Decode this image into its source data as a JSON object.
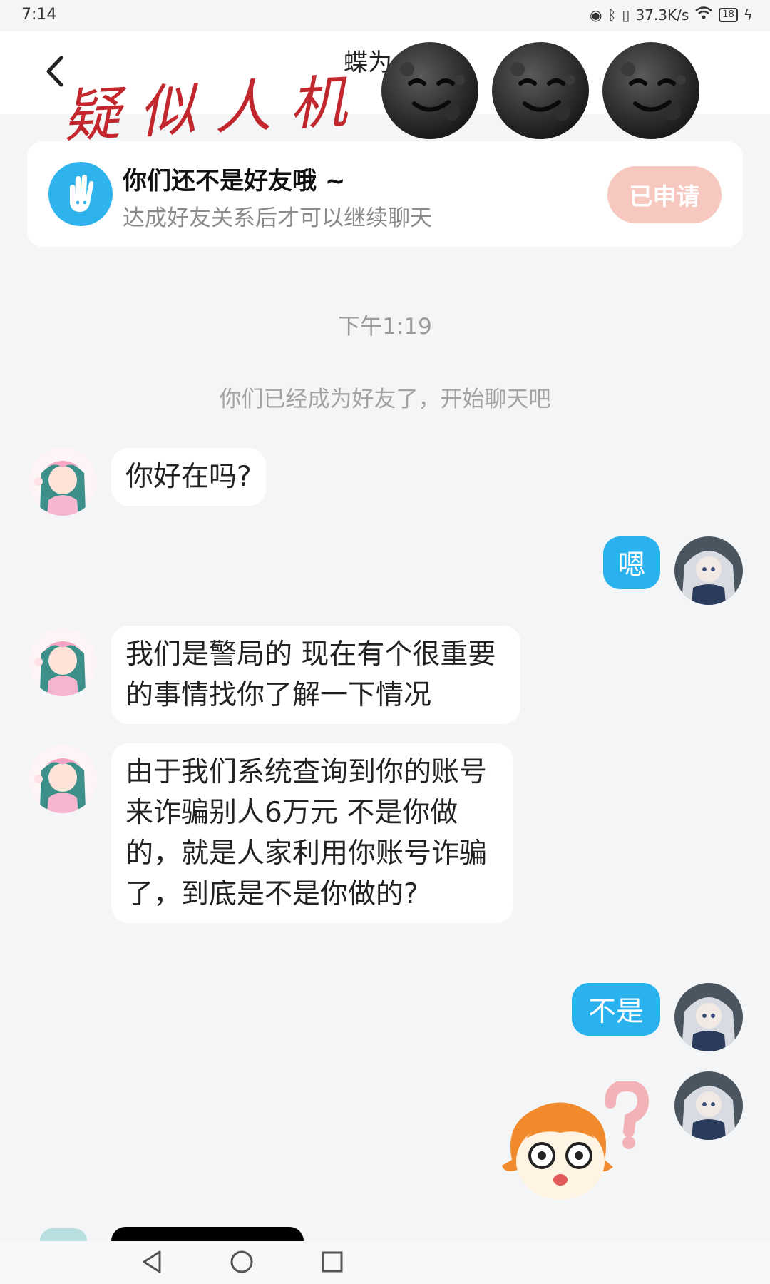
{
  "status_bar": {
    "time": "7:14",
    "net_speed": "37.3K/s",
    "battery": "18"
  },
  "header": {
    "title": "蝶为",
    "overlay_stamp": "疑似人机"
  },
  "notice": {
    "title": "你们还不是好友哦 ~",
    "subtitle": "达成好友关系后才可以继续聊天",
    "button_label": "已申请"
  },
  "chat": {
    "time_label": "下午1:19",
    "system_message": "你们已经成为好友了，开始聊天吧",
    "messages": [
      {
        "side": "in",
        "text": "你好在吗?"
      },
      {
        "side": "out",
        "text": "嗯"
      },
      {
        "side": "in",
        "text": "我们是警局的 现在有个很重要的事情找你了解一下情况"
      },
      {
        "side": "in",
        "text": "由于我们系统查询到你的账号来诈骗别人6万元 不是你做的，就是人家利用你账号诈骗了，到底是不是你做的?"
      },
      {
        "side": "out",
        "text": "不是"
      },
      {
        "side": "out",
        "sticker": "confused-face-sticker"
      }
    ]
  },
  "colors": {
    "accent": "#29b2ee",
    "background": "#f4f5f6",
    "stamp_red": "#c1272d",
    "applied_button": "#f7c8bf"
  }
}
